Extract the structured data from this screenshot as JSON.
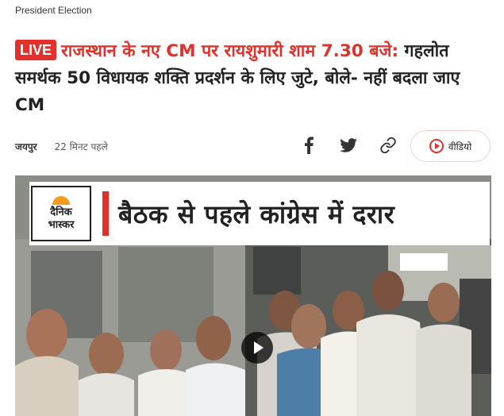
{
  "category": "President Election",
  "headline": {
    "badge": "LIVE",
    "highlight": "राजस्थान के नए CM पर रायशुमारी शाम 7.30 बजे:",
    "rest": " गहलोत समर्थक 50 विधायक शक्ति प्रदर्शन के लिए जुटे, बोले- नहीं बदला जाए CM"
  },
  "meta": {
    "place": "जयपुर",
    "time": "22 मिनट पहले"
  },
  "share": {
    "icons": [
      "facebook-icon",
      "twitter-icon",
      "link-icon"
    ]
  },
  "video_button": {
    "label": "वीडियो"
  },
  "video": {
    "logo_line1": "दैनिक",
    "logo_line2": "भास्कर",
    "banner_title": "बैठक से पहले कांग्रेस में दरार"
  },
  "colors": {
    "accent": "#e0322b",
    "logo_orange": "#f29a1d"
  }
}
